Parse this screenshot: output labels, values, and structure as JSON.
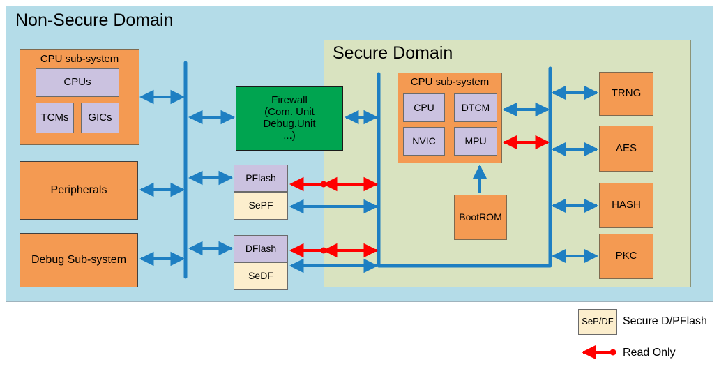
{
  "diagram": {
    "title_nonsecure": "Non-Secure Domain",
    "title_secure": "Secure Domain"
  },
  "colors": {
    "nonsecure_bg": "#b4dce8",
    "secure_bg": "#d9e3c0",
    "orange": "#f49a52",
    "lavender": "#cbc2e0",
    "cream": "#fceecd",
    "green": "#00a450",
    "bus_blue": "#1e7fc2",
    "arrow_blue": "#1e7fc2",
    "arrow_red": "#ff0000",
    "border_gray": "#7f7f7f",
    "border_dark": "#3f3f3f"
  },
  "nonsecure": {
    "cpu_subsystem": {
      "label": "CPU sub-system",
      "children": [
        {
          "label": "CPUs"
        },
        {
          "label": "TCMs"
        },
        {
          "label": "GICs"
        }
      ]
    },
    "peripherals": {
      "label": "Peripherals"
    },
    "debug_subsystem": {
      "label": "Debug Sub-system"
    },
    "firewall": {
      "label": "Firewall\n(Com. Unit\nDebug.Unit\n...)",
      "line1": "Firewall",
      "line2": "(Com. Unit",
      "line3": "Debug.Unit",
      "line4": "...)"
    },
    "flash_blocks": [
      {
        "top": "PFlash",
        "bottom": "SePF"
      },
      {
        "top": "DFlash",
        "bottom": "SeDF"
      }
    ]
  },
  "secure": {
    "cpu_subsystem": {
      "label": "CPU sub-system",
      "children": [
        {
          "label": "CPU"
        },
        {
          "label": "DTCM"
        },
        {
          "label": "NVIC"
        },
        {
          "label": "MPU"
        }
      ]
    },
    "bootrom": {
      "label": "BootROM"
    },
    "crypto_blocks": [
      {
        "label": "TRNG"
      },
      {
        "label": "AES"
      },
      {
        "label": "HASH"
      },
      {
        "label": "PKC"
      }
    ]
  },
  "legend": {
    "swatch_label": "SeP/DF",
    "swatch_text": "Secure D/PFlash",
    "arrow_text": "Read Only"
  }
}
